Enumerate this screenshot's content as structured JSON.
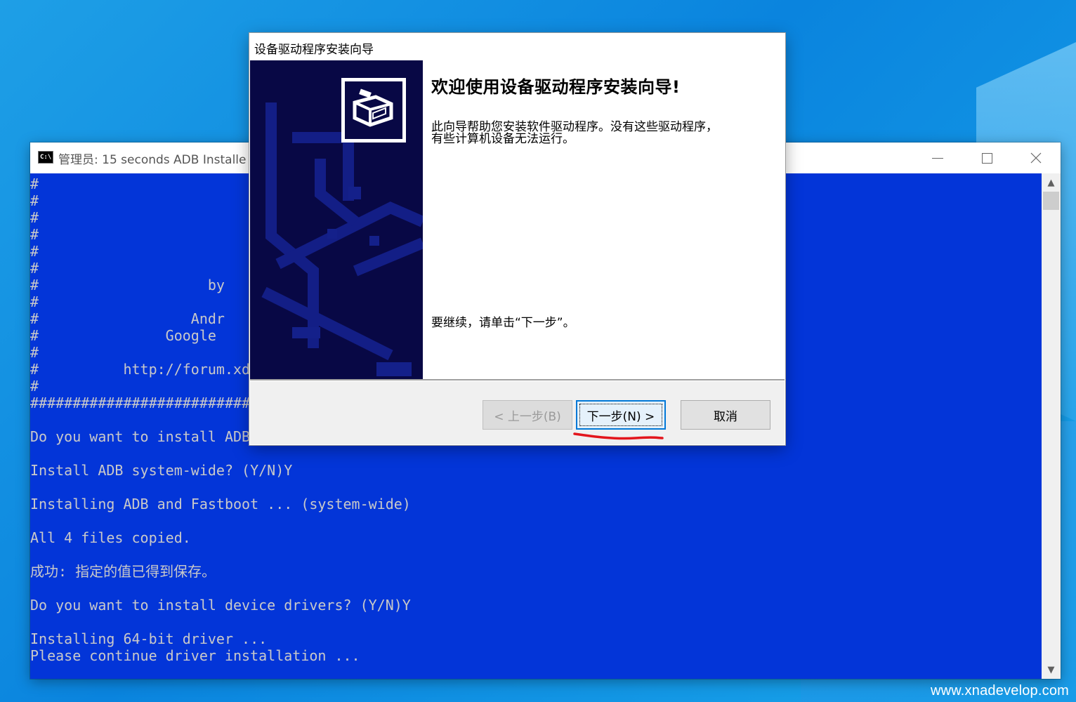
{
  "console": {
    "icon_label": "C:\\",
    "title": "管理员:  15 seconds ADB Installe",
    "lines": [
      "#",
      "#",
      "#",
      "#",
      "#",
      "#",
      "#                    by",
      "#",
      "#                  Andr",
      "#               Google",
      "#",
      "#          http://forum.xd",
      "#",
      "###########################",
      "",
      "Do you want to install ADB",
      "",
      "Install ADB system-wide? (Y/N)Y",
      "",
      "Installing ADB and Fastboot ... (system-wide)",
      "",
      "All 4 files copied.",
      "",
      "成功: 指定的值已得到保存。",
      "",
      "Do you want to install device drivers? (Y/N)Y",
      "",
      "Installing 64-bit driver ...",
      "Please continue driver installation ..."
    ]
  },
  "wizard": {
    "title": "设备驱动程序安装向导",
    "heading": "欢迎使用设备驱动程序安装向导!",
    "description": "此向导帮助您安装软件驱动程序。没有这些驱动程序，有些计算机设备无法运行。",
    "continue_text": "要继续，请单击“下一步”。",
    "buttons": {
      "back": "< 上一步(B)",
      "next": "下一步(N) >",
      "cancel": "取消"
    },
    "icon": "hardware-device-icon"
  },
  "watermark": "www.xnadevelop.com",
  "colors": {
    "console_bg": "#0335d8",
    "console_text": "#c9c9c9",
    "wizard_side": "#080845",
    "accent": "#0078d7",
    "annotation": "#e3151c"
  }
}
